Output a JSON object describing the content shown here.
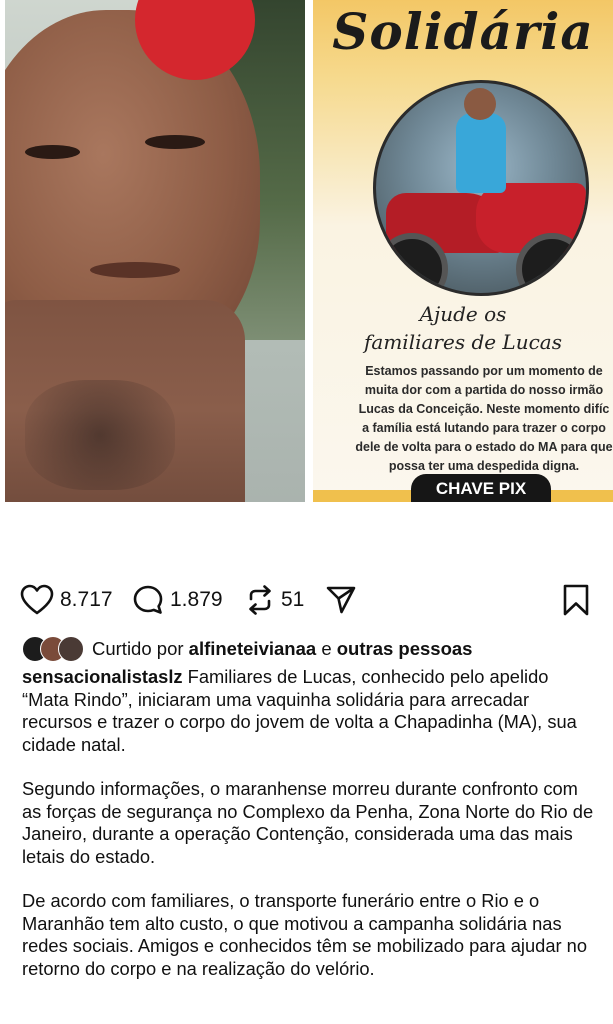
{
  "post_image": {
    "poster_title": "Solidária",
    "poster_help": "Ajude os\nfamiliares de Lucas",
    "poster_description": "Estamos passando por um momento de\nmuita dor com a partida do nosso irmão\nLucas da Conceição. Neste momento difíc\na família está lutando para trazer o corpo\ndele de volta para o estado do MA para que\npossa ter uma despedida digna.",
    "poster_pix_label": "CHAVE PIX"
  },
  "actions": {
    "likes": "8.717",
    "comments": "1.879",
    "reposts": "51"
  },
  "liked_by": {
    "prefix": "Curtido por",
    "user": "alfineteivianaa",
    "connector": "e",
    "others": "outras pessoas"
  },
  "caption": {
    "username": "sensacionalistaslz",
    "paragraph1": "Familiares de Lucas, conhecido pelo apelido “Mata Rindo”, iniciaram uma vaquinha solidária para arrecadar recursos e trazer o corpo do jovem de volta a Chapadinha (MA), sua cidade natal.",
    "paragraph2": "Segundo informações, o maranhense morreu durante confronto com as forças de segurança no Complexo da Penha, Zona Norte do Rio de Janeiro, durante a operação Contenção, considerada uma das mais letais do estado.",
    "paragraph3": "De acordo com familiares, o transporte funerário entre o Rio e o Maranhão tem alto custo, o que motivou a campanha solidária nas redes sociais. Amigos e conhecidos têm se mobilizado para ajudar no retorno do corpo e na realização do velório."
  },
  "colors": {
    "text": "#111111",
    "poster_yellow": "#f3c766",
    "hair_red": "#d4272e",
    "motorcycle_red": "#c8202b"
  }
}
